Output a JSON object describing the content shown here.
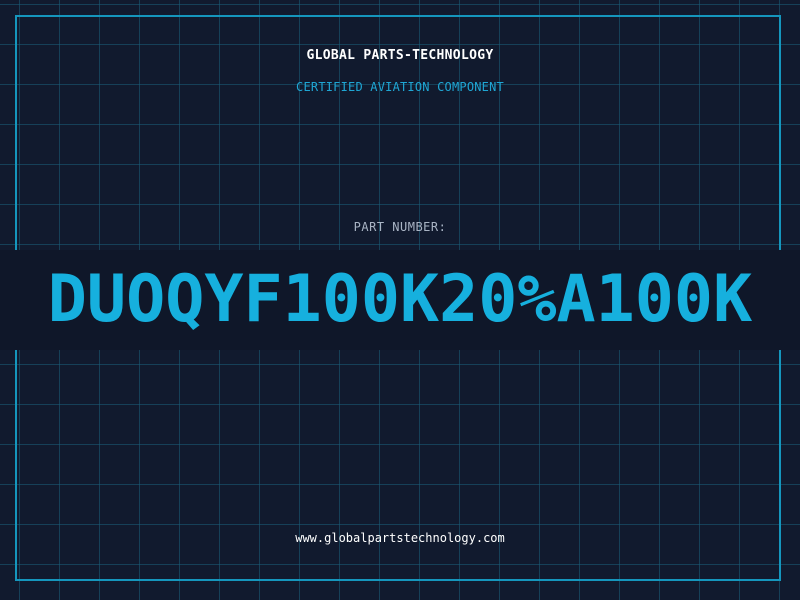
{
  "header": {
    "company_name": "GLOBAL PARTS-TECHNOLOGY",
    "subtitle": "CERTIFIED AVIATION COMPONENT"
  },
  "part": {
    "label": "PART NUMBER:",
    "number": "DUOQYF100K20%A100K"
  },
  "footer": {
    "website": "www.globalpartstechnology.com"
  },
  "colors": {
    "background": "#111a2e",
    "grid": "#1a5f7a",
    "frame": "#1596bd",
    "accent": "#16b0de",
    "text_primary": "#ffffff",
    "text_muted": "#a9b4c4"
  }
}
